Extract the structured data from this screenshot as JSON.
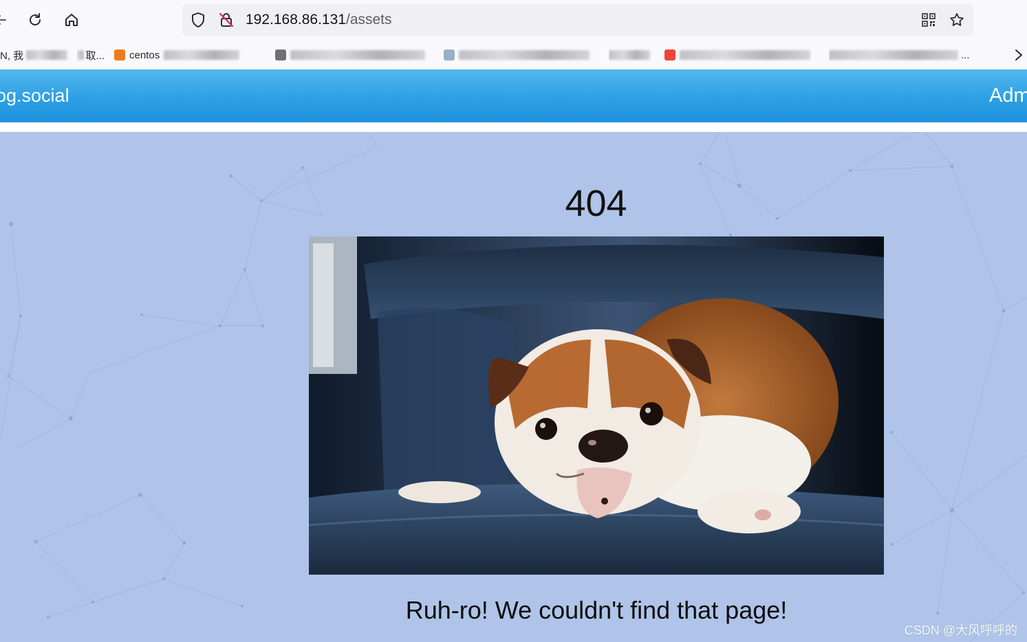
{
  "browser": {
    "address_host": "192.168.86.131",
    "address_path": "/assets",
    "bookmarks": [
      {
        "label": "N, 我"
      },
      {
        "label": "取..."
      },
      {
        "label": "centos"
      },
      {
        "label": ""
      },
      {
        "label": ""
      },
      {
        "label": ""
      },
      {
        "label": "..."
      }
    ],
    "icons": [
      "back-icon",
      "reload-icon",
      "home-icon",
      "shield-icon",
      "insecure-lock-icon",
      "qr-code-icon",
      "star-icon",
      "chevron-right-icon"
    ]
  },
  "site": {
    "brand": "og.social",
    "nav_admin": "Adm"
  },
  "page": {
    "error_code": "404",
    "message": "Ruh-ro! We couldn't find that page!",
    "watermark": "CSDN @大风呼呼的"
  },
  "colors": {
    "navbar": "#2e9fe4",
    "page_background": "#afc4e8"
  }
}
